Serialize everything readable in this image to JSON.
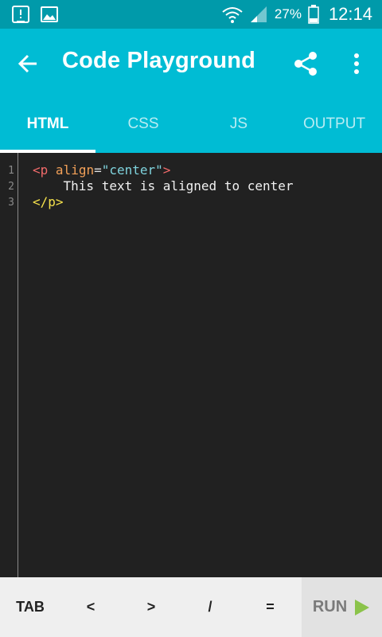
{
  "status_bar": {
    "battery_percent": "27%",
    "time": "12:14"
  },
  "app_bar": {
    "title": "Code Playground"
  },
  "tabs": [
    {
      "label": "HTML",
      "active": true
    },
    {
      "label": "CSS",
      "active": false
    },
    {
      "label": "JS",
      "active": false
    },
    {
      "label": "OUTPUT",
      "active": false
    }
  ],
  "editor": {
    "line_numbers": [
      "1",
      "2",
      "3"
    ],
    "line1": {
      "open_bracket": "<",
      "tag": "p",
      "attr": "align",
      "eq": "=",
      "value": "\"center\"",
      "close_bracket": ">"
    },
    "line2": "    This text is aligned to center",
    "line3": "</p>"
  },
  "toolbar": {
    "keys": [
      "TAB",
      "<",
      ">",
      "/",
      "="
    ],
    "run_label": "RUN"
  },
  "colors": {
    "status_bar": "#009aaa",
    "app_bar": "#00bcd4",
    "run_icon": "#8bc34a"
  }
}
